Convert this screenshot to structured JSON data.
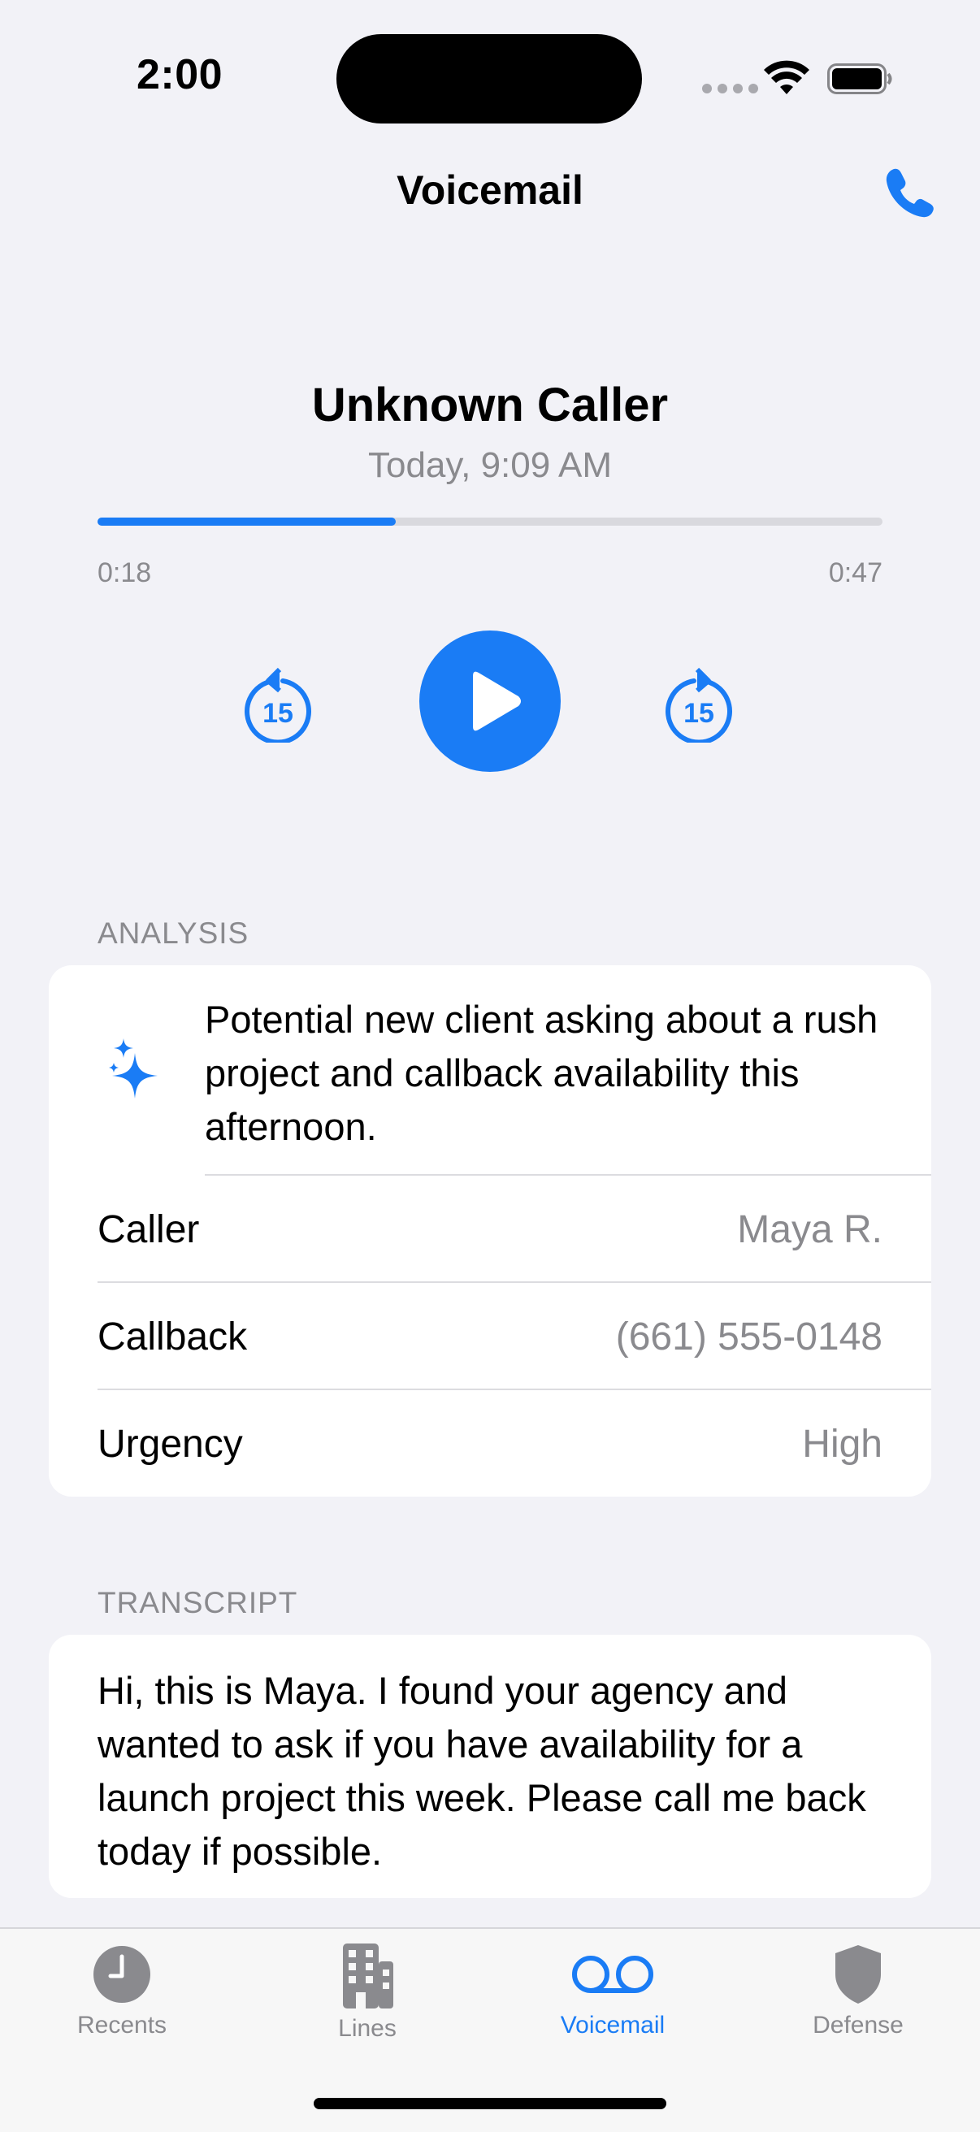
{
  "status_bar": {
    "time": "2:00"
  },
  "nav": {
    "title": "Voicemail"
  },
  "player": {
    "caller": "Unknown Caller",
    "date": "Today, 9:09 AM",
    "elapsed": "0:18",
    "duration": "0:47",
    "progress_fraction": 0.38
  },
  "analysis": {
    "header": "ANALYSIS",
    "summary": "Potential new client asking about a rush project and callback availability this afternoon.",
    "rows": [
      {
        "label": "Caller",
        "value": "Maya R."
      },
      {
        "label": "Callback",
        "value": "(661) 555-0148"
      },
      {
        "label": "Urgency",
        "value": "High"
      }
    ]
  },
  "transcript": {
    "header": "TRANSCRIPT",
    "text": "Hi, this is Maya. I found your agency and wanted to ask if you have availability for a launch project this week. Please call me back today if possible."
  },
  "tabs": [
    {
      "label": "Recents",
      "icon": "clock-icon"
    },
    {
      "label": "Lines",
      "icon": "building-icon"
    },
    {
      "label": "Voicemail",
      "icon": "voicemail-icon",
      "active": true
    },
    {
      "label": "Defense",
      "icon": "shield-icon"
    }
  ],
  "colors": {
    "accent": "#1A7CF5",
    "background": "#F2F2F7",
    "secondary_text": "#8A8A8E"
  }
}
